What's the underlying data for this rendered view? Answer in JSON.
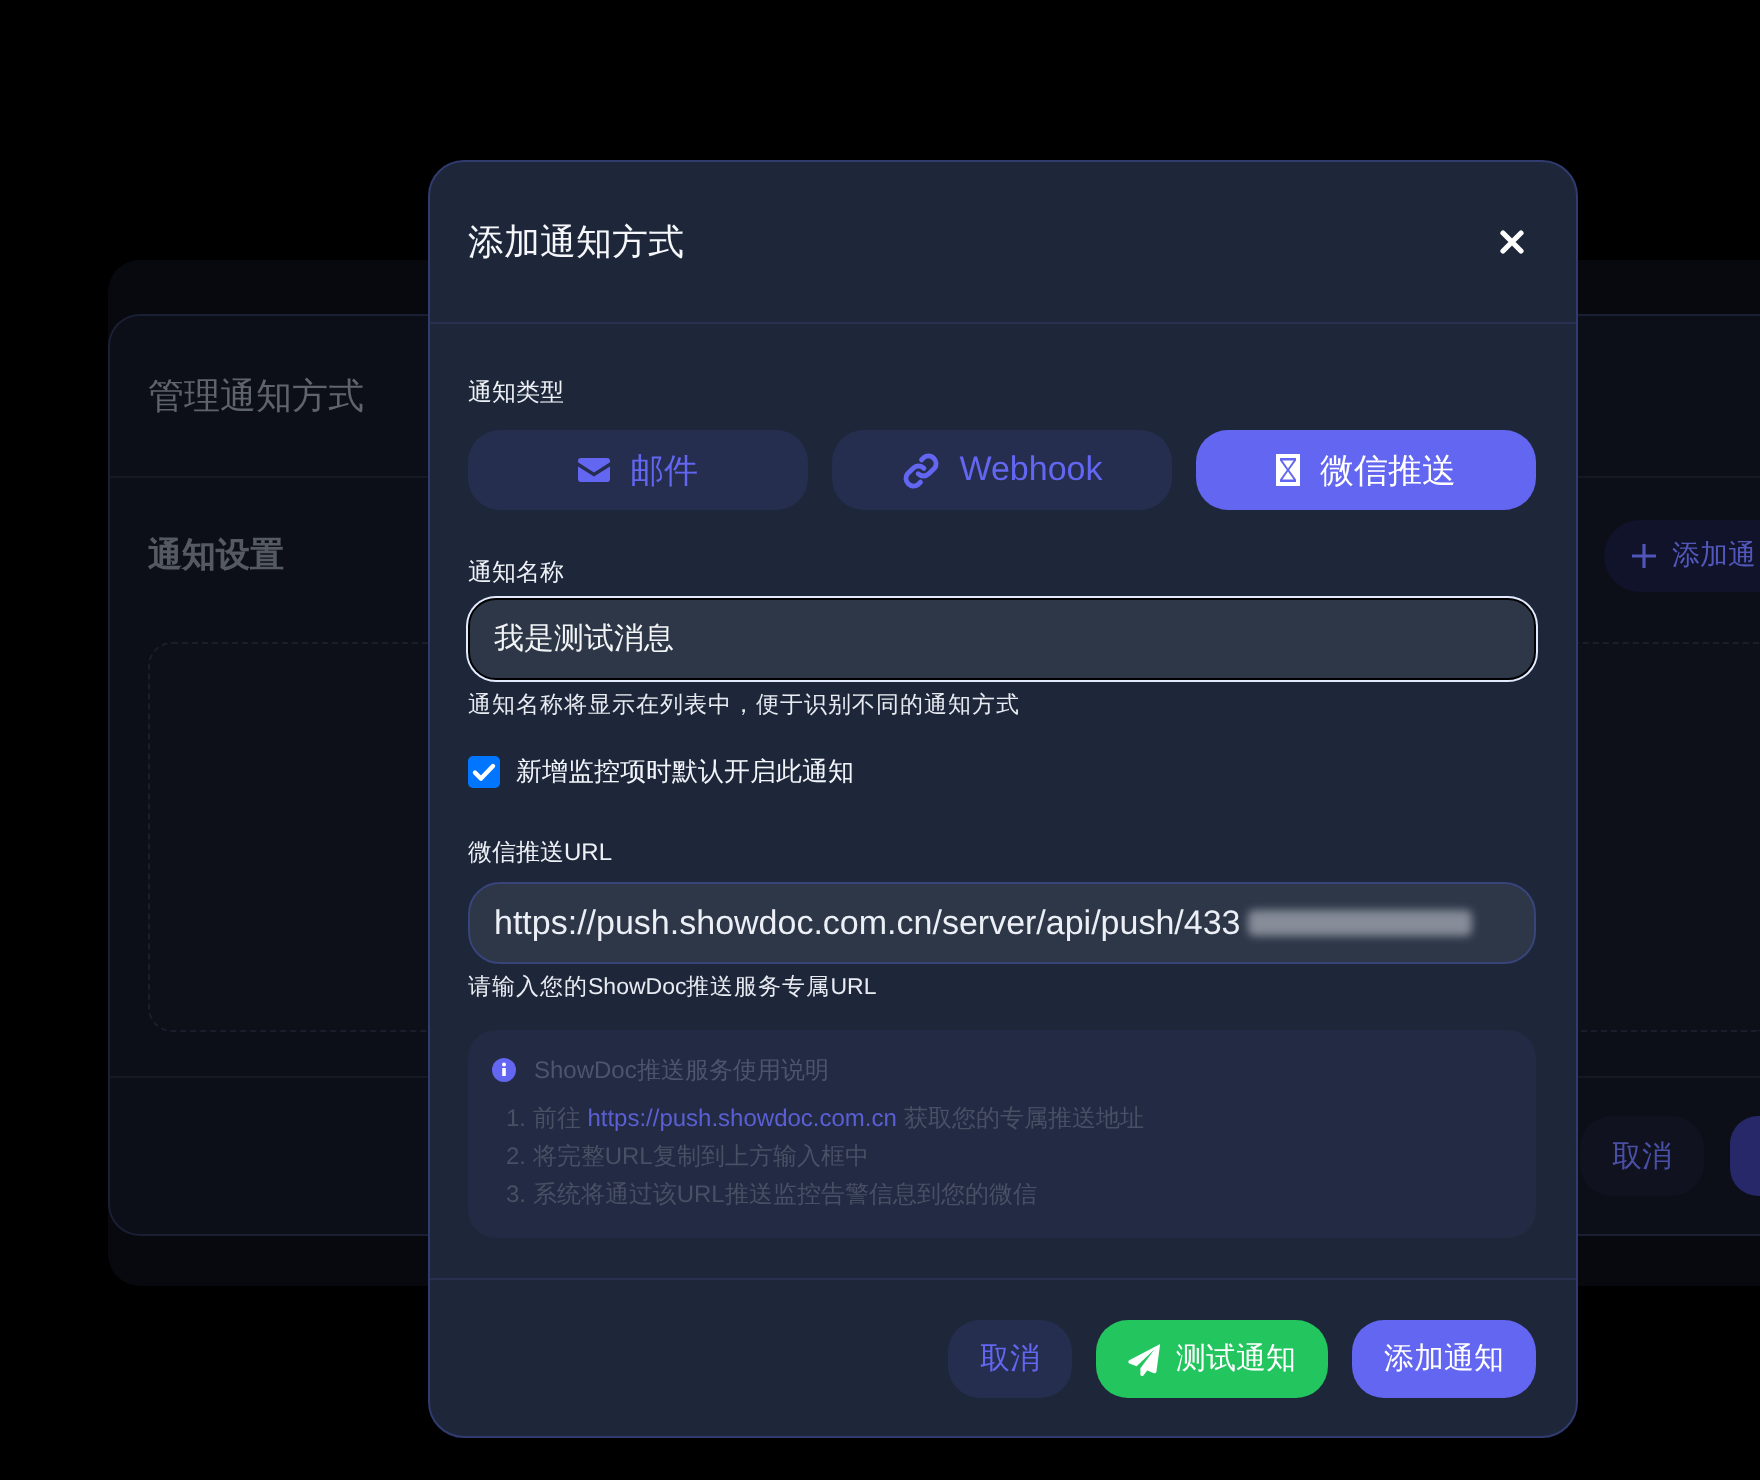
{
  "manage_window": {
    "title": "管理通知方式",
    "section_title": "通知设置",
    "add_button": "添加通",
    "cancel_button": "取消"
  },
  "dialog": {
    "title": "添加通知方式",
    "type_label": "通知类型",
    "types": [
      {
        "label": "邮件",
        "kind": "mail",
        "selected": false
      },
      {
        "label": "Webhook",
        "kind": "link",
        "selected": false
      },
      {
        "label": "微信推送",
        "kind": "wechat",
        "selected": true
      }
    ],
    "name_field": {
      "label": "通知名称",
      "value": "我是测试消息",
      "focused": true,
      "help": "通知名称将显示在列表中，便于识别不同的通知方式"
    },
    "default_on": {
      "label": "新增监控项时默认开启此通知",
      "checked": true
    },
    "url_field": {
      "label": "微信推送URL",
      "value": "https://push.showdoc.com.cn/server/api/push/433",
      "help": "请输入您的ShowDoc推送服务专属URL"
    },
    "info": {
      "title": "ShowDoc推送服务使用说明",
      "steps": [
        {
          "text": "1. 前往 ",
          "link": "https://push.showdoc.com.cn",
          "after": " 获取您的专属推送地址"
        },
        {
          "text": "2. 将完整URL复制到上方输入框中"
        },
        {
          "text": "3. 系统将通过该URL推送监控告警信息到您的微信"
        }
      ]
    },
    "buttons": [
      {
        "label": "取消",
        "kind": "cancel"
      },
      {
        "label": "测试通知",
        "kind": "test"
      },
      {
        "label": "添加通知",
        "kind": "submit"
      }
    ]
  }
}
